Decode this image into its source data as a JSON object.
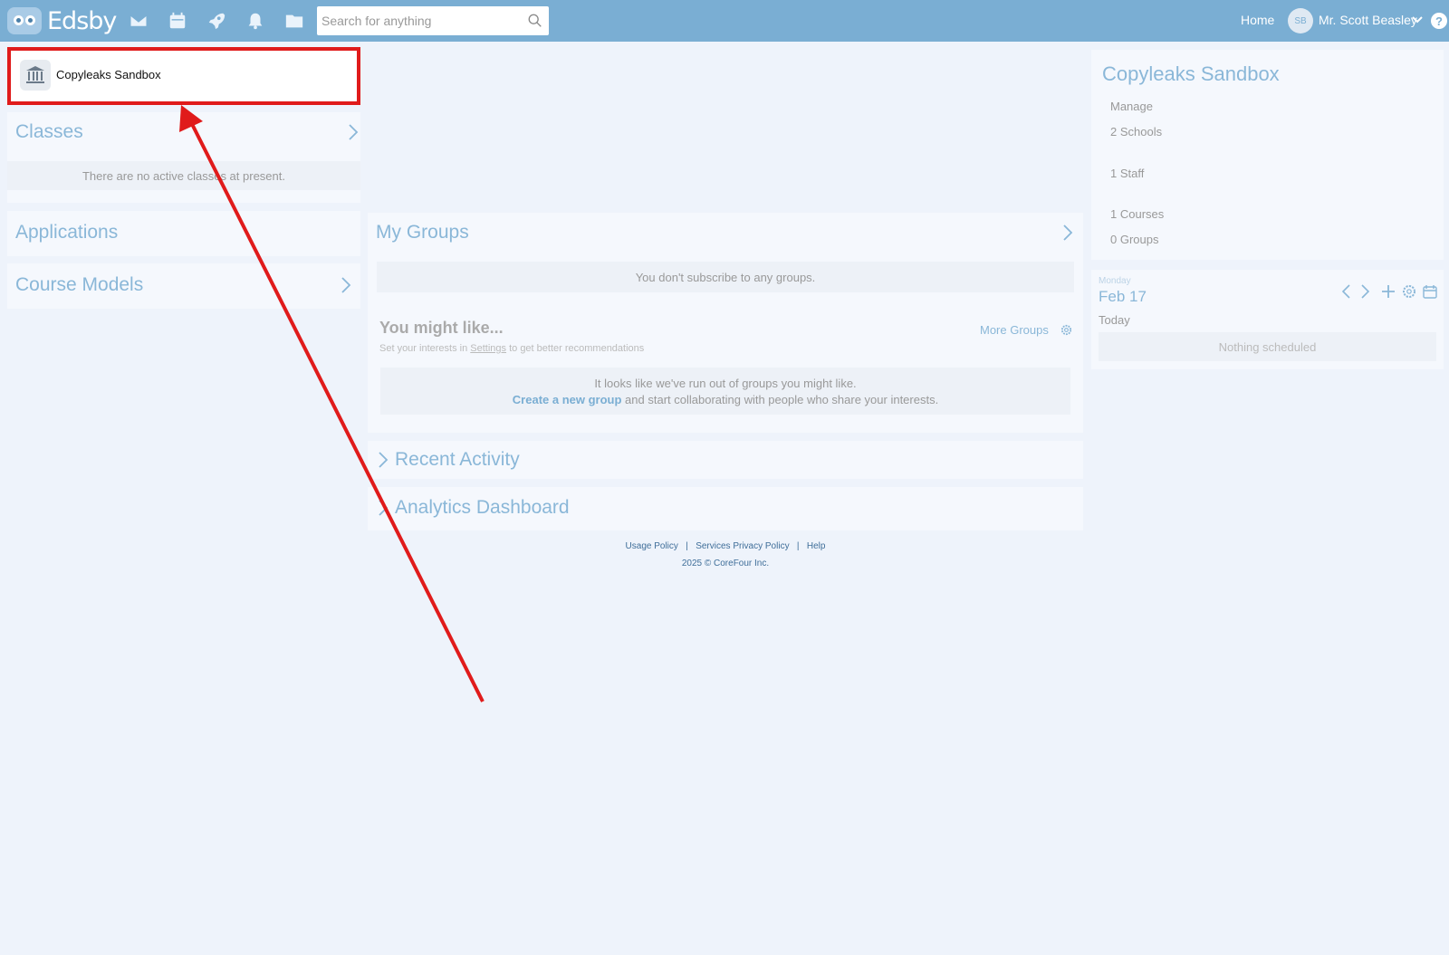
{
  "topbar": {
    "logo_text": "Edsby",
    "search_placeholder": "Search for anything",
    "home_label": "Home",
    "avatar_initials": "SB",
    "user_name": "Mr. Scott Beasley",
    "help_label": "?"
  },
  "school_card": {
    "name": "Copyleaks Sandbox"
  },
  "classes": {
    "title": "Classes",
    "empty_text": "There are no active classes at present."
  },
  "applications": {
    "title": "Applications"
  },
  "course_models": {
    "title": "Course Models"
  },
  "my_groups": {
    "title": "My Groups",
    "empty_text": "You don't subscribe to any groups.",
    "you_might_like": {
      "title": "You might like...",
      "subtitle_pre": "Set your interests in ",
      "subtitle_link": "Settings",
      "subtitle_post": " to get better recommendations",
      "more_groups": "More Groups",
      "empty_line1": "It looks like we've run out of groups you might like.",
      "create_link": "Create a new group",
      "empty_line2_post": " and start collaborating with people who share your interests."
    }
  },
  "recent_activity": {
    "title": "Recent Activity"
  },
  "analytics_dashboard": {
    "title": "Analytics Dashboard"
  },
  "footer": {
    "usage_policy": "Usage Policy",
    "sep": "|",
    "privacy_policy": "Services Privacy Policy",
    "help": "Help",
    "copyright": "2025 © CoreFour Inc."
  },
  "org_panel": {
    "title": "Copyleaks Sandbox",
    "manage": "Manage",
    "schools": "2 Schools",
    "staff": "1 Staff",
    "courses": "1 Courses",
    "groups": "0 Groups"
  },
  "calendar": {
    "day": "Monday",
    "date": "Feb 17",
    "today": "Today",
    "nothing": "Nothing scheduled"
  },
  "colors": {
    "topbar": "#7aaed3",
    "accent": "#8ab7d8",
    "annotation_red": "#e01b1b"
  }
}
